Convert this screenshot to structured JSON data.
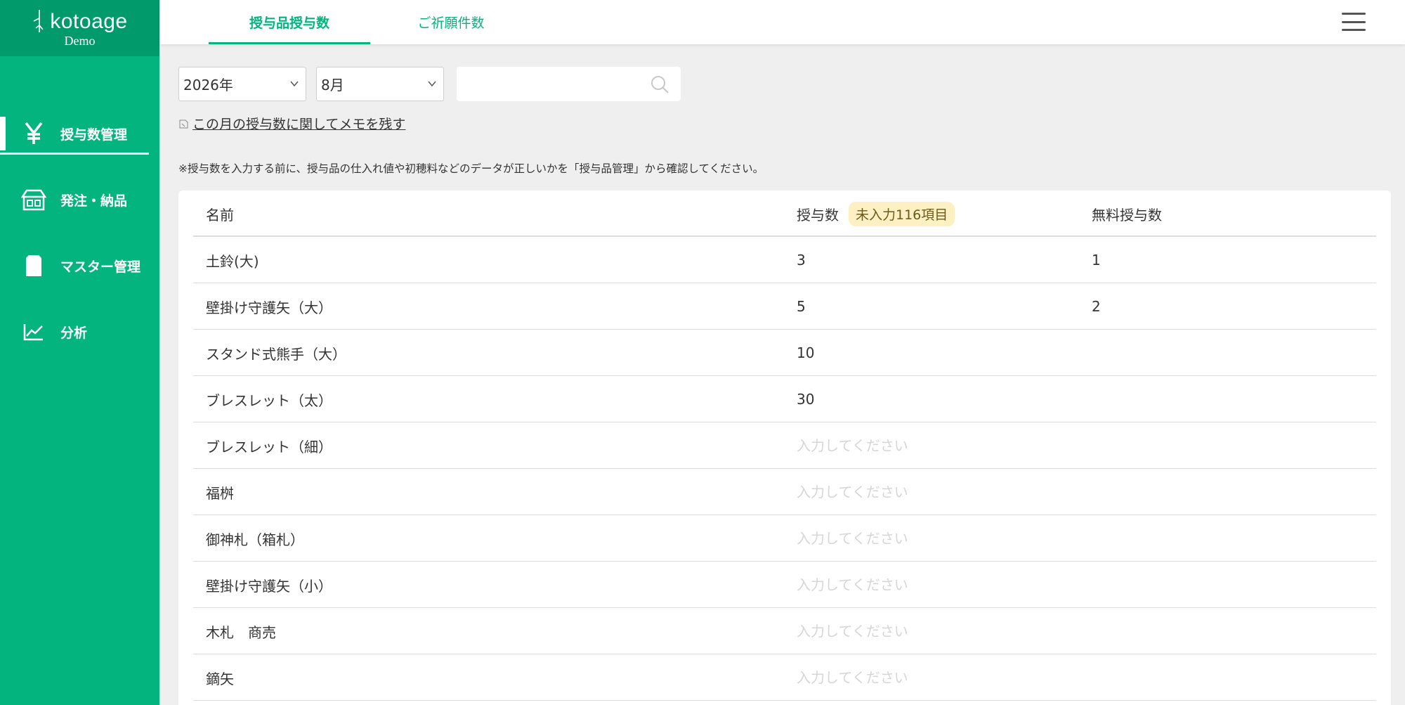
{
  "brand": {
    "name": "kotoage",
    "sub": "Demo"
  },
  "colors": {
    "primary": "#03b47f",
    "primary_dark": "#019a6b",
    "badge_bg": "#fdf1c4"
  },
  "sidebar": {
    "items": [
      {
        "label": "授与数管理",
        "icon": "yen-icon",
        "active": true
      },
      {
        "label": "発注・納品",
        "icon": "shop-icon",
        "active": false
      },
      {
        "label": "マスター管理",
        "icon": "card-icon",
        "active": false
      },
      {
        "label": "分析",
        "icon": "chart-icon",
        "active": false
      }
    ]
  },
  "header": {
    "tabs": [
      {
        "label": "授与品授与数",
        "active": true
      },
      {
        "label": "ご祈願件数",
        "active": false
      }
    ],
    "menu_icon": "hamburger-icon"
  },
  "filters": {
    "year": "2026年",
    "month": "8月",
    "search_value": "",
    "search_icon": "search-icon"
  },
  "memo_link": "この月の授与数に関してメモを残す",
  "notice": "※授与数を入力する前に、授与品の仕入れ値や初穂料などのデータが正しいかを「授与品管理」から確認してください。",
  "table": {
    "headers": {
      "name": "名前",
      "qty": "授与数",
      "badge": "未入力116項目",
      "free": "無料授与数"
    },
    "placeholder": "入力してください",
    "rows": [
      {
        "name": "土鈴(大)",
        "qty": "3",
        "free": "1"
      },
      {
        "name": "壁掛け守護矢（大）",
        "qty": "5",
        "free": "2"
      },
      {
        "name": "スタンド式熊手（大）",
        "qty": "10",
        "free": ""
      },
      {
        "name": "ブレスレット（太）",
        "qty": "30",
        "free": ""
      },
      {
        "name": "ブレスレット（細）",
        "qty": "",
        "free": ""
      },
      {
        "name": "福桝",
        "qty": "",
        "free": ""
      },
      {
        "name": "御神札（箱札）",
        "qty": "",
        "free": ""
      },
      {
        "name": "壁掛け守護矢（小）",
        "qty": "",
        "free": ""
      },
      {
        "name": "木札　商売",
        "qty": "",
        "free": ""
      },
      {
        "name": "鏑矢",
        "qty": "",
        "free": ""
      }
    ]
  }
}
